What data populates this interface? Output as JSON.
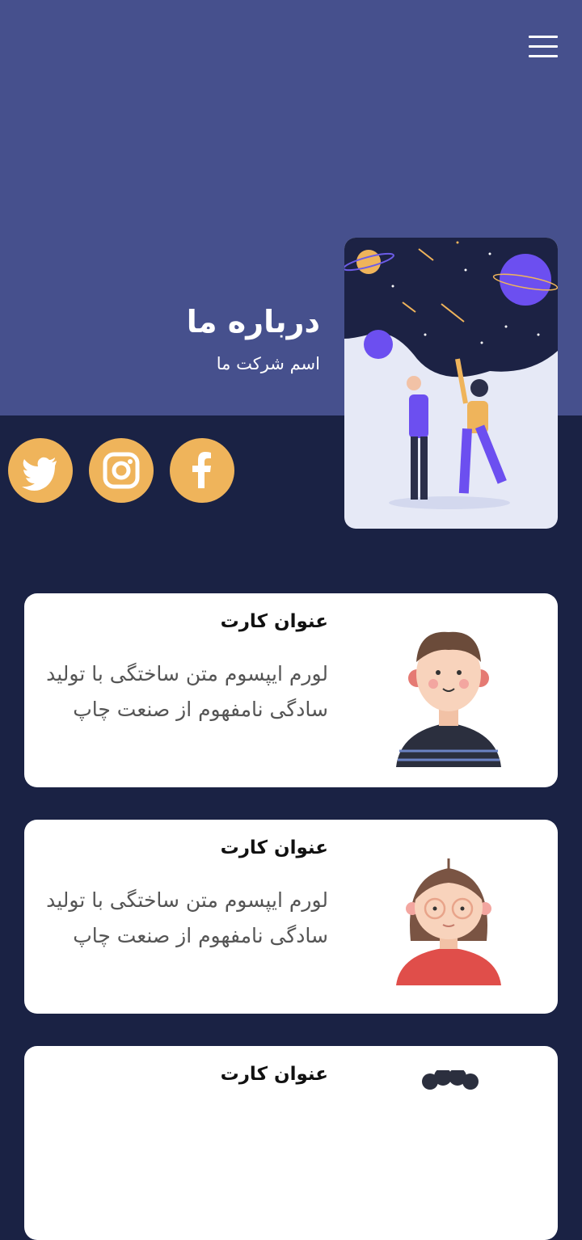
{
  "header": {
    "menu_icon": "hamburger-menu-icon",
    "title": "درباره ما",
    "subtitle": "اسم شرکت ما",
    "illustration": "people-looking-at-space-illustration"
  },
  "social": [
    {
      "name": "twitter",
      "icon": "twitter-icon"
    },
    {
      "name": "instagram",
      "icon": "instagram-icon"
    },
    {
      "name": "facebook",
      "icon": "facebook-icon"
    }
  ],
  "cards": [
    {
      "title": "عنوان کارت",
      "text": "لورم ایپسوم متن ساختگی با تولید سادگی نامفهوم از صنعت چاپ",
      "avatar": "boy-avatar"
    },
    {
      "title": "عنوان کارت",
      "text": "لورم ایپسوم متن ساختگی با تولید سادگی نامفهوم از صنعت چاپ",
      "avatar": "girl-with-glasses-avatar"
    },
    {
      "title": "عنوان کارت",
      "text": "",
      "avatar": "curly-hair-avatar"
    }
  ],
  "colors": {
    "hero_bg": "#46508d",
    "page_bg": "#1a2244",
    "social_bg": "#efb45b",
    "card_bg": "#ffffff"
  }
}
